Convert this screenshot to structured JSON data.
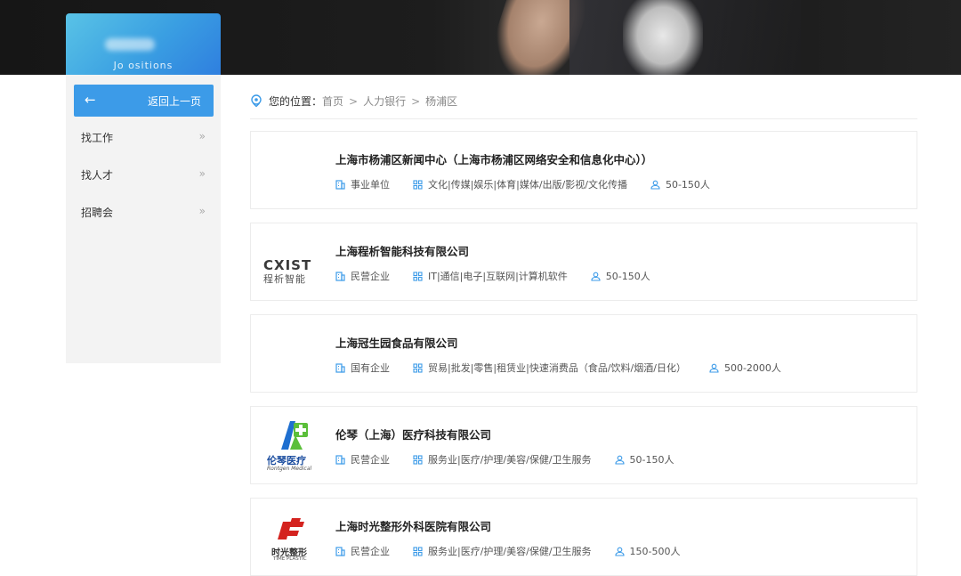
{
  "sidebar": {
    "header_title": "Jo    ositions",
    "back_label": "返回上一页",
    "back_arrow": "←",
    "items": [
      {
        "label": "找工作",
        "chevron": "»"
      },
      {
        "label": "找人才",
        "chevron": "»"
      },
      {
        "label": "招聘会",
        "chevron": "»"
      }
    ]
  },
  "breadcrumb": {
    "prefix": "您的位置：",
    "crumbs": [
      "首页",
      "人力银行",
      "杨浦区"
    ],
    "separator": ">"
  },
  "companies": [
    {
      "name": "上海市杨浦区新闻中心（上海市杨浦区网络安全和信息化中心））",
      "type": "事业单位",
      "industry": "文化|传媒|娱乐|体育|媒体/出版/影视/文化传播",
      "size": "50-150人",
      "logo": ""
    },
    {
      "name": "上海程析智能科技有限公司",
      "type": "民营企业",
      "industry": "IT|通信|电子|互联网|计算机软件",
      "size": "50-150人",
      "logo": "cxist-logo",
      "logo_text_top": "CXIST",
      "logo_text_bottom": "程析智能"
    },
    {
      "name": "上海冠生园食品有限公司",
      "type": "国有企业",
      "industry": "贸易|批发|零售|租赁业|快速消费品（食品/饮料/烟酒/日化）",
      "size": "500-2000人",
      "logo": ""
    },
    {
      "name": "伦琴（上海）医疗科技有限公司",
      "type": "民营企业",
      "industry": "服务业|医疗/护理/美容/保健/卫生服务",
      "size": "50-150人",
      "logo": "rontgen-logo",
      "logo_text_top": "伦琴医疗",
      "logo_text_bottom": "Rontgen Medical"
    },
    {
      "name": "上海时光整形外科医院有限公司",
      "type": "民营企业",
      "industry": "服务业|医疗/护理/美容/保健/卫生服务",
      "size": "150-500人",
      "logo": "timeplastic-logo",
      "logo_text_top": "时光整形",
      "logo_text_bottom": "TIME PLASTIC"
    }
  ],
  "colors": {
    "accent": "#3c9be8",
    "icon": "#3c9be8"
  }
}
